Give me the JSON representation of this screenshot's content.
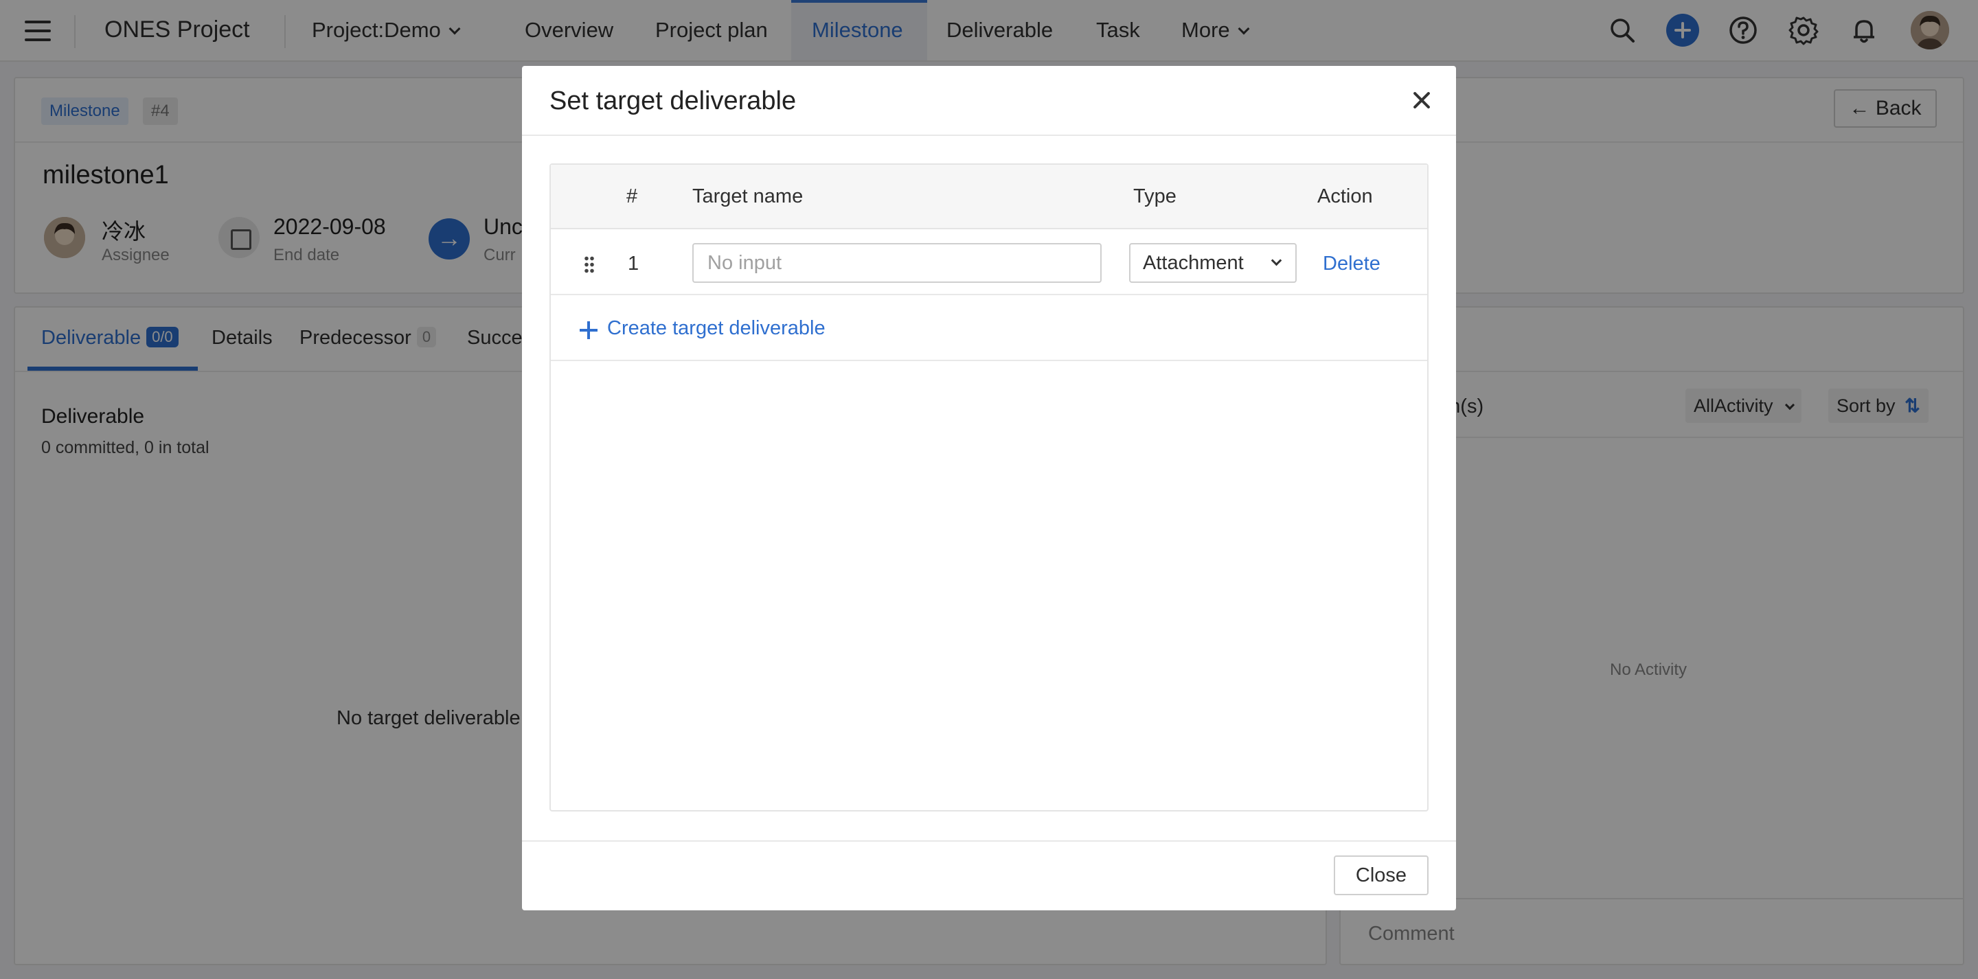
{
  "topbar": {
    "app_name": "ONES Project",
    "project_selector": "Project:Demo",
    "tabs": [
      {
        "label": "Overview"
      },
      {
        "label": "Project plan"
      },
      {
        "label": "Milestone"
      },
      {
        "label": "Deliverable"
      },
      {
        "label": "Task"
      },
      {
        "label": "More"
      }
    ],
    "active_tab": "Milestone",
    "accent_color": "#2f6fcf"
  },
  "header": {
    "tag_type": "Milestone",
    "tag_number": "#4",
    "back_label": "Back",
    "title": "milestone1",
    "assignee_name": "冷冰",
    "assignee_label": "Assignee",
    "end_date": "2022-09-08",
    "end_date_label": "End date",
    "status_value_partial": "Unc",
    "status_label_partial": "Curr"
  },
  "panel_tabs": [
    {
      "label": "Deliverable",
      "badge": "0/0"
    },
    {
      "label": "Details"
    },
    {
      "label": "Predecessor",
      "badge": "0"
    },
    {
      "label": "Succe"
    }
  ],
  "deliverable_section": {
    "title": "Deliverable",
    "subtitle": "0 committed, 0 in total",
    "empty_text": "No target deliverable"
  },
  "activity": {
    "items_partial": "em(s)",
    "filter_value": "AllActivity",
    "sort_label": "Sort by",
    "empty_text": "No Activity",
    "comment_placeholder": "Comment"
  },
  "modal": {
    "title": "Set target deliverable",
    "columns": {
      "num": "#",
      "name": "Target name",
      "type": "Type",
      "action": "Action"
    },
    "rows": [
      {
        "num": "1",
        "name_value": "",
        "name_placeholder": "No input",
        "type": "Attachment",
        "action": "Delete"
      }
    ],
    "create_label": "Create target deliverable",
    "close_label": "Close"
  }
}
